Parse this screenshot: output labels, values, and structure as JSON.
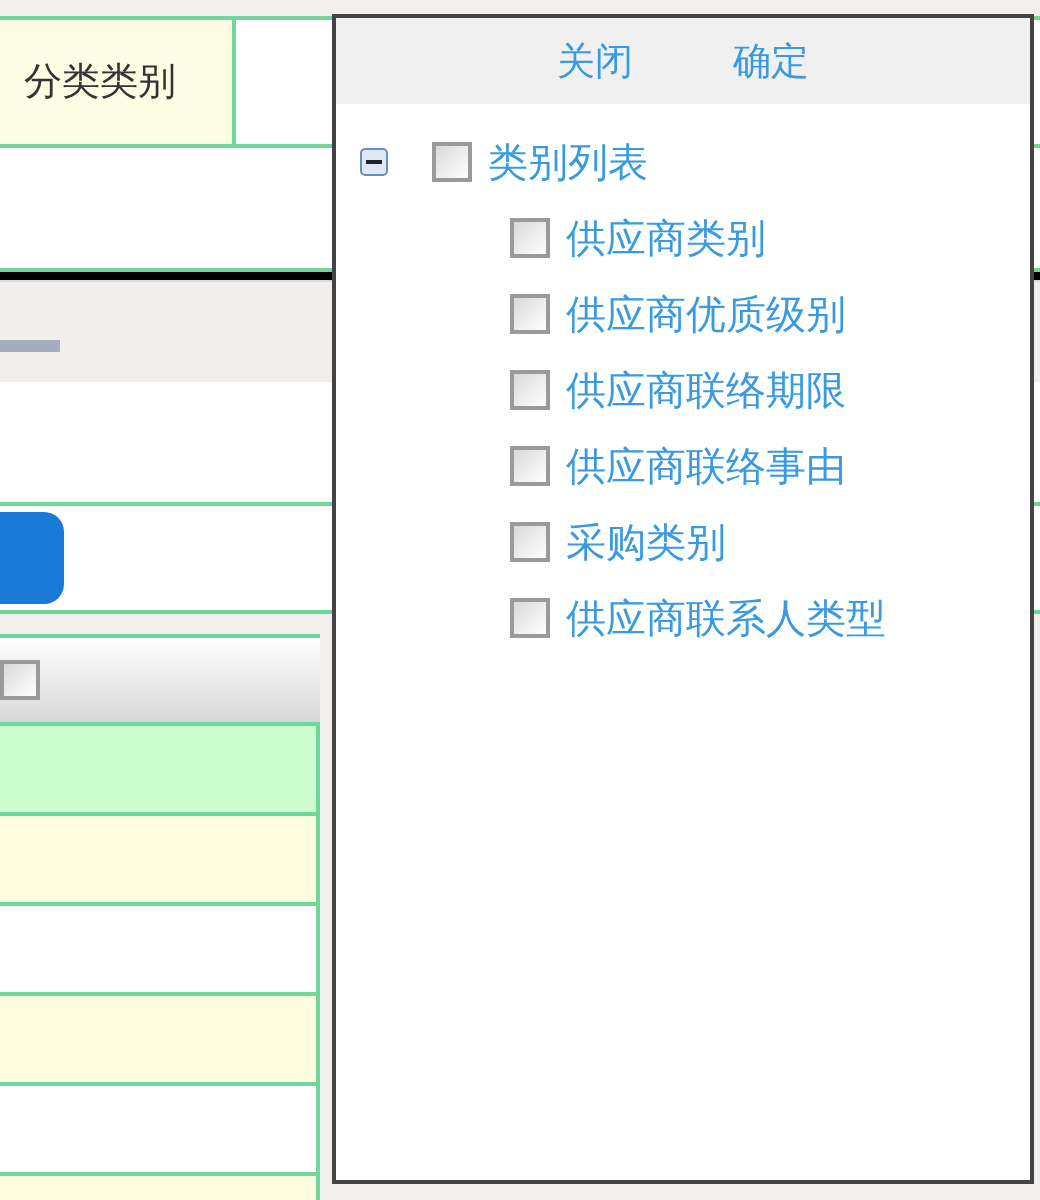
{
  "form": {
    "field_label": "分类类别"
  },
  "table": {
    "header_checked": false,
    "rows": [
      {
        "selected": true
      },
      {
        "selected": false
      },
      {
        "selected": false
      },
      {
        "selected": false
      },
      {
        "selected": false
      },
      {
        "selected": false
      }
    ]
  },
  "popup": {
    "buttons": [
      "关闭",
      "确定"
    ],
    "tree": {
      "label": "类别列表",
      "checked": false,
      "expanded": true,
      "children": [
        {
          "label": "供应商类别",
          "checked": false
        },
        {
          "label": "供应商优质级别",
          "checked": false
        },
        {
          "label": "供应商联络期限",
          "checked": false
        },
        {
          "label": "供应商联络事由",
          "checked": false
        },
        {
          "label": "采购类别",
          "checked": false
        },
        {
          "label": "供应商联系人类型",
          "checked": false
        }
      ]
    }
  }
}
